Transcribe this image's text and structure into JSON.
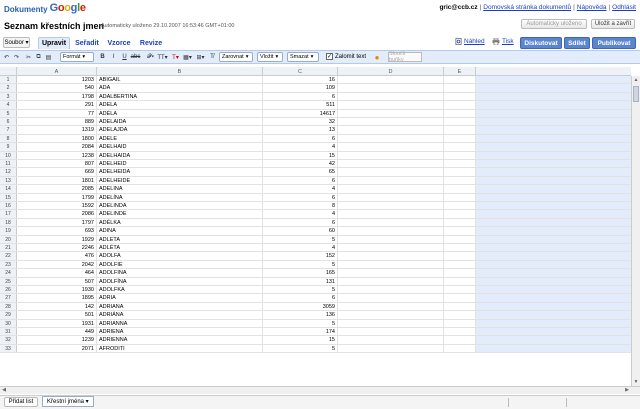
{
  "header": {
    "logo_part1": "Dokumenty",
    "logo_part2": [
      "G",
      "o",
      "o",
      "g",
      "l",
      "e"
    ],
    "user_email": "gric@ccb.cz",
    "links": [
      "Domovská stránka dokumentů",
      "Nápověda",
      "Odhlásit"
    ],
    "doc_title": "Seznam křestních jmen",
    "autosave_status": "Automaticky uloženo 29.10.2007 16:53:46 GMT+01:00",
    "btn_autosave": "Automaticky uloženo",
    "btn_save_close": "Uložit a zavřít"
  },
  "menubar": {
    "file": "Soubor ▾",
    "tabs": [
      "Upravit",
      "Seřadit",
      "Vzorce",
      "Revize"
    ],
    "preview": "Náhled",
    "print": "Tisk",
    "discuss": "Diskutovat",
    "share": "Sdílet",
    "publish": "Publikovat"
  },
  "toolbar": {
    "format": "Formát",
    "align": "Zarovnat",
    "insert": "Vložit",
    "delete": "Smazat",
    "wrap_text": "Zalomit text",
    "merge_cells": "Sloučit buňky"
  },
  "columns": [
    "A",
    "B",
    "C",
    "D",
    "E"
  ],
  "rows": [
    {
      "n": "1",
      "a": "1203",
      "b": "ABIGAIL",
      "c": "16"
    },
    {
      "n": "2",
      "a": "540",
      "b": "ADA",
      "c": "109"
    },
    {
      "n": "3",
      "a": "1798",
      "b": "ADALBERTINA",
      "c": "6"
    },
    {
      "n": "4",
      "a": "291",
      "b": "ADELA",
      "c": "511"
    },
    {
      "n": "5",
      "a": "77",
      "b": "ADÉLA",
      "c": "14617"
    },
    {
      "n": "6",
      "a": "889",
      "b": "ADELAIDA",
      "c": "32"
    },
    {
      "n": "7",
      "a": "1319",
      "b": "ADELAJDA",
      "c": "13"
    },
    {
      "n": "8",
      "a": "1800",
      "b": "ADELE",
      "c": "6"
    },
    {
      "n": "9",
      "a": "2084",
      "b": "ADELHAID",
      "c": "4"
    },
    {
      "n": "10",
      "a": "1238",
      "b": "ADELHAIDA",
      "c": "15"
    },
    {
      "n": "11",
      "a": "807",
      "b": "ADELHEID",
      "c": "42"
    },
    {
      "n": "12",
      "a": "669",
      "b": "ADELHEIDA",
      "c": "65"
    },
    {
      "n": "13",
      "a": "1801",
      "b": "ADELHEIDE",
      "c": "6"
    },
    {
      "n": "14",
      "a": "2085",
      "b": "ADELINA",
      "c": "4"
    },
    {
      "n": "15",
      "a": "1799",
      "b": "ADELÍNA",
      "c": "6"
    },
    {
      "n": "16",
      "a": "1592",
      "b": "ADELINDA",
      "c": "8"
    },
    {
      "n": "17",
      "a": "2086",
      "b": "ADELINDE",
      "c": "4"
    },
    {
      "n": "18",
      "a": "1797",
      "b": "ADÉLKA",
      "c": "6"
    },
    {
      "n": "19",
      "a": "693",
      "b": "ADINA",
      "c": "60"
    },
    {
      "n": "20",
      "a": "1929",
      "b": "ADLETA",
      "c": "5"
    },
    {
      "n": "21",
      "a": "2246",
      "b": "ADLÉTA",
      "c": "4"
    },
    {
      "n": "22",
      "a": "476",
      "b": "ADOLFA",
      "c": "152"
    },
    {
      "n": "23",
      "a": "2042",
      "b": "ADOLFIE",
      "c": "5"
    },
    {
      "n": "24",
      "a": "464",
      "b": "ADOLFINA",
      "c": "165"
    },
    {
      "n": "25",
      "a": "507",
      "b": "ADOLFÍNA",
      "c": "131"
    },
    {
      "n": "26",
      "a": "1930",
      "b": "ADOLFKA",
      "c": "5"
    },
    {
      "n": "27",
      "a": "1895",
      "b": "ADRIA",
      "c": "6"
    },
    {
      "n": "28",
      "a": "142",
      "b": "ADRIANA",
      "c": "3059"
    },
    {
      "n": "29",
      "a": "501",
      "b": "ADRIÁNA",
      "c": "136"
    },
    {
      "n": "30",
      "a": "1931",
      "b": "ADRIANNA",
      "c": "5"
    },
    {
      "n": "31",
      "a": "449",
      "b": "ADRIENA",
      "c": "174"
    },
    {
      "n": "32",
      "a": "1239",
      "b": "ADRIENNA",
      "c": "15"
    },
    {
      "n": "33",
      "a": "2071",
      "b": "AFRODITI",
      "c": "5"
    }
  ],
  "bottom": {
    "add_sheet": "Přidat list",
    "sheet_tab": "Křestní jména ▾"
  },
  "colors": {
    "accent_blue": "#5b86cf",
    "toolbar_bg": "#e3ecfa",
    "link": "#1a3ec0"
  }
}
